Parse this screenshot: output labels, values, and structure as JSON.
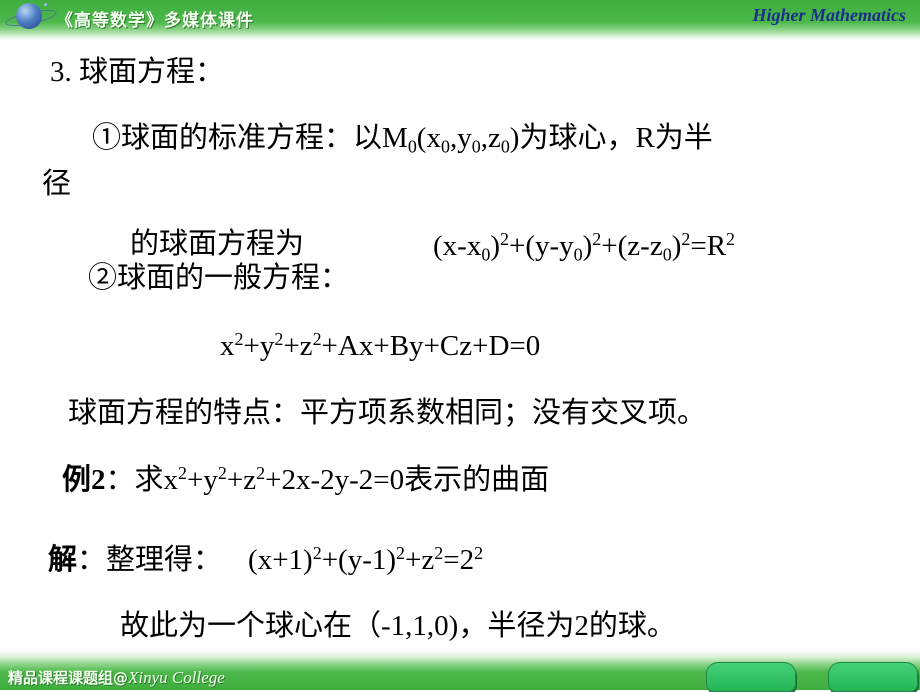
{
  "header": {
    "course_title": "《高等数学》多媒体课件",
    "brand": "Higher Mathematics",
    "colors": {
      "band": "#4cb84a",
      "brand_text": "#1a2f8c"
    }
  },
  "footer": {
    "group": "精品课程课题组@",
    "college": "Xinyu College",
    "nav_buttons": [
      "prev-slide",
      "next-slide"
    ],
    "colors": {
      "button": "#2fc063"
    }
  },
  "slide": {
    "section_title": "3. 球面方程：",
    "item1": {
      "marker": "①",
      "lead": "球面的标准方程：以M",
      "m_sub": "0",
      "p1": "(x",
      "s1": "0",
      "p2": ",y",
      "s2": "0",
      "p3": ",z",
      "s3": "0",
      "p4": ")为球心，R为半",
      "wrap": "径",
      "line2_text": "的球面方程为",
      "formula": {
        "a": "(x-x",
        "a_sub": "0",
        "a_close": ")",
        "a_sup": "2",
        "b": "+(y-y",
        "b_sub": "0",
        "b_close": ")",
        "b_sup": "2",
        "c": "+(z-z",
        "c_sub": "0",
        "c_close": ")",
        "c_sup": "2",
        "d": "=R",
        "d_sup": "2"
      }
    },
    "item2": {
      "marker": "②",
      "label": "球面的一般方程：",
      "formula": {
        "x": "x",
        "x_sup": "2",
        "y": "+y",
        "y_sup": "2",
        "z": "+z",
        "z_sup": "2",
        "rest": "+Ax+By+Cz+D=0"
      }
    },
    "feature": "球面方程的特点：平方项系数相同；没有交叉项。",
    "example": {
      "label": "例2",
      "colon": "：",
      "q1": "求x",
      "q1_sup": "2",
      "q2": "+y",
      "q2_sup": "2",
      "q3": "+z",
      "q3_sup": "2",
      "q4": "+2x-2y-2=0表示的曲面"
    },
    "solution": {
      "label": "解",
      "colon": "：",
      "step": "整理得：",
      "f1": "(x+1)",
      "f1_sup": "2",
      "f2": "+(y-1)",
      "f2_sup": "2",
      "f3": "+z",
      "f3_sup": "2",
      "f4": "=2",
      "f4_sup": "2",
      "conclusion": "故此为一个球心在（-1,1,0)，半径为2的球。"
    }
  }
}
